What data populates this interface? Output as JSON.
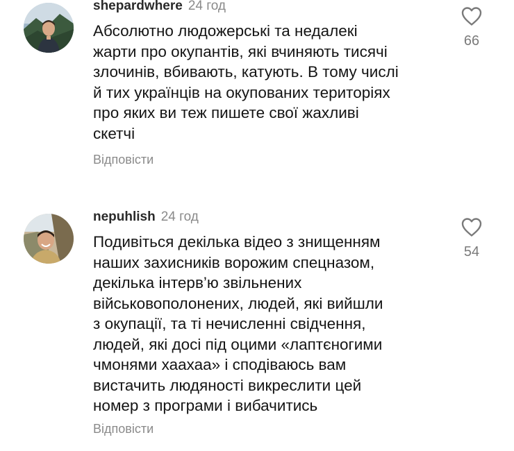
{
  "comments": [
    {
      "username": "shepardwhere",
      "time": "24 год",
      "text_lines": [
        "Абсолютно людожерські та недалекі",
        "жарти про окупантів, які вчиняють тисячі",
        "злочинів, вбивають, катують. В тому числі",
        "й тих українців на окупованих територіях",
        "про яких ви теж пишете свої жахливі",
        "скетчі"
      ],
      "reply_label": "Відповісти",
      "likes": "66",
      "like_icon": "heart-outline-icon"
    },
    {
      "username": "nepuhlish",
      "time": "24 год",
      "text_lines": [
        "Подивіться декілька відео з знищенням",
        "наших захисників ворожим спецназом,",
        "декілька інтерв’ю звільнених",
        "військовополонених, людей, які вийшли",
        "з окупації, та ті нечисленні свідчення,",
        "людей, які досі під оцими «лаптєногими",
        "чмонями хаахаа» і сподіваюсь вам",
        "вистачить людяності викреслити цей",
        "номер з програми і вибачитись"
      ],
      "reply_label": "Відповісти",
      "likes": "54",
      "like_icon": "heart-outline-icon"
    }
  ],
  "colors": {
    "text": "#141414",
    "username": "#2a2a2a",
    "meta": "#8a8a8a",
    "icon": "#7a7a7a",
    "background": "#ffffff"
  }
}
